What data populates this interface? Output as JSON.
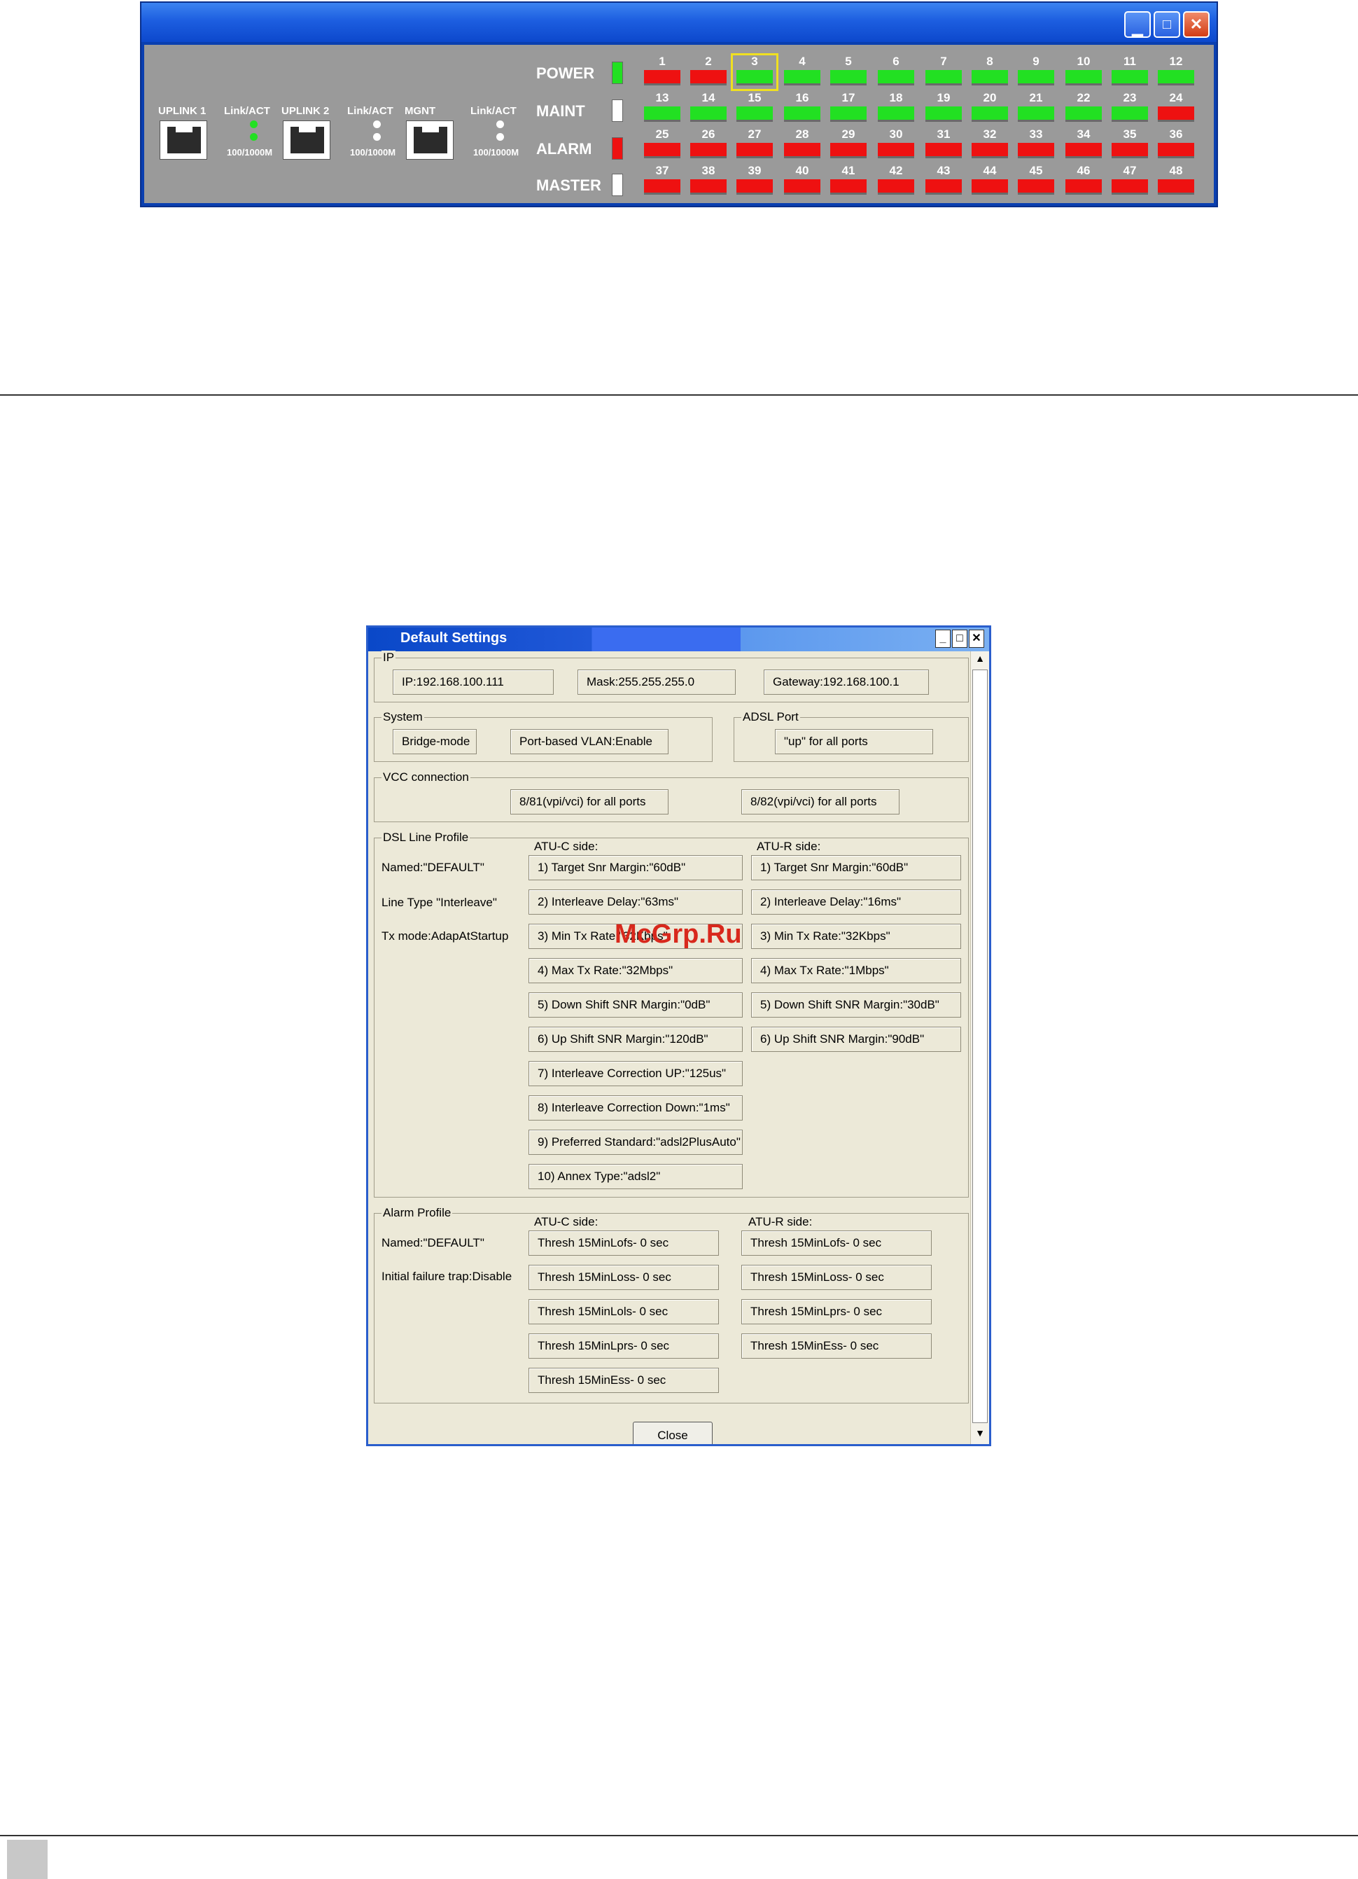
{
  "panel": {
    "uplinks": [
      {
        "name": "UPLINK 1",
        "link": "Link/ACT",
        "speed": "100/1000M",
        "led1": "#22e022",
        "led2": "#22e022"
      },
      {
        "name": "UPLINK 2",
        "link": "Link/ACT",
        "speed": "100/1000M",
        "led1": "#ffffff",
        "led2": "#ffffff"
      },
      {
        "name": "MGNT",
        "link": "Link/ACT",
        "speed": "100/1000M",
        "led1": "#ffffff",
        "led2": "#ffffff"
      }
    ],
    "system_leds": [
      {
        "label": "POWER",
        "color": "#22e022"
      },
      {
        "label": "MAINT",
        "color": "#ffffff"
      },
      {
        "label": "ALARM",
        "color": "#ee1111"
      },
      {
        "label": "MASTER",
        "color": "#ffffff"
      }
    ],
    "ports": [
      {
        "n": "1",
        "s": "red"
      },
      {
        "n": "2",
        "s": "red"
      },
      {
        "n": "3",
        "s": "green"
      },
      {
        "n": "4",
        "s": "green"
      },
      {
        "n": "5",
        "s": "green"
      },
      {
        "n": "6",
        "s": "green"
      },
      {
        "n": "7",
        "s": "green"
      },
      {
        "n": "8",
        "s": "green"
      },
      {
        "n": "9",
        "s": "green"
      },
      {
        "n": "10",
        "s": "green"
      },
      {
        "n": "11",
        "s": "green"
      },
      {
        "n": "12",
        "s": "green"
      },
      {
        "n": "13",
        "s": "green"
      },
      {
        "n": "14",
        "s": "green"
      },
      {
        "n": "15",
        "s": "green"
      },
      {
        "n": "16",
        "s": "green"
      },
      {
        "n": "17",
        "s": "green"
      },
      {
        "n": "18",
        "s": "green"
      },
      {
        "n": "19",
        "s": "green"
      },
      {
        "n": "20",
        "s": "green"
      },
      {
        "n": "21",
        "s": "green"
      },
      {
        "n": "22",
        "s": "green"
      },
      {
        "n": "23",
        "s": "green"
      },
      {
        "n": "24",
        "s": "red"
      },
      {
        "n": "25",
        "s": "red"
      },
      {
        "n": "26",
        "s": "red"
      },
      {
        "n": "27",
        "s": "red"
      },
      {
        "n": "28",
        "s": "red"
      },
      {
        "n": "29",
        "s": "red"
      },
      {
        "n": "30",
        "s": "red"
      },
      {
        "n": "31",
        "s": "red"
      },
      {
        "n": "32",
        "s": "red"
      },
      {
        "n": "33",
        "s": "red"
      },
      {
        "n": "34",
        "s": "red"
      },
      {
        "n": "35",
        "s": "red"
      },
      {
        "n": "36",
        "s": "red"
      },
      {
        "n": "37",
        "s": "red"
      },
      {
        "n": "38",
        "s": "red"
      },
      {
        "n": "39",
        "s": "red"
      },
      {
        "n": "40",
        "s": "red"
      },
      {
        "n": "41",
        "s": "red"
      },
      {
        "n": "42",
        "s": "red"
      },
      {
        "n": "43",
        "s": "red"
      },
      {
        "n": "44",
        "s": "red"
      },
      {
        "n": "45",
        "s": "red"
      },
      {
        "n": "46",
        "s": "red"
      },
      {
        "n": "47",
        "s": "red"
      },
      {
        "n": "48",
        "s": "red"
      }
    ],
    "selected_port": "3",
    "colors": {
      "green": "#22e022",
      "red": "#ee1111",
      "selection": "#f0e020"
    }
  },
  "dialog": {
    "title": "Default Settings",
    "ip": {
      "legend": "IP",
      "ip": "IP:192.168.100.111",
      "mask": "Mask:255.255.255.0",
      "gateway": "Gateway:192.168.100.1"
    },
    "system": {
      "legend": "System",
      "mode": "Bridge-mode",
      "vlan": "Port-based VLAN:Enable"
    },
    "adsl_port": {
      "legend": "ADSL Port",
      "value": "\"up\" for all ports"
    },
    "vcc": {
      "legend": "VCC connection",
      "vcc1": "8/81(vpi/vci) for all ports",
      "vcc2": "8/82(vpi/vci) for all ports"
    },
    "dsl_profile": {
      "legend": "DSL Line Profile",
      "named": "Named:\"DEFAULT\"",
      "line_type": "Line Type \"Interleave\"",
      "tx_mode": "Tx mode:AdapAtStartup",
      "atuc_header": "ATU-C side:",
      "atur_header": "ATU-R side:",
      "atuc": [
        "1) Target Snr Margin:\"60dB\"",
        "2) Interleave Delay:\"63ms\"",
        "3) Min Tx Rate:\"32Kbps\"",
        "4) Max Tx Rate:\"32Mbps\"",
        "5) Down Shift SNR Margin:\"0dB\"",
        "6) Up Shift SNR Margin:\"120dB\"",
        "7) Interleave Correction UP:\"125us\"",
        "8) Interleave Correction Down:\"1ms\"",
        "9) Preferred Standard:\"adsl2PlusAuto\"",
        "10) Annex Type:\"adsl2\""
      ],
      "atur": [
        "1) Target Snr Margin:\"60dB\"",
        "2) Interleave Delay:\"16ms\"",
        "3) Min Tx Rate:\"32Kbps\"",
        "4) Max Tx Rate:\"1Mbps\"",
        "5) Down Shift SNR Margin:\"30dB\"",
        "6) Up Shift SNR Margin:\"90dB\""
      ]
    },
    "alarm_profile": {
      "legend": "Alarm Profile",
      "named": "Named:\"DEFAULT\"",
      "trap": "Initial failure trap:Disable",
      "atuc_header": "ATU-C side:",
      "atur_header": "ATU-R side:",
      "atuc": [
        "Thresh 15MinLofs- 0 sec",
        "Thresh 15MinLoss- 0 sec",
        "Thresh 15MinLols- 0 sec",
        "Thresh 15MinLprs- 0 sec",
        "Thresh 15MinEss- 0 sec"
      ],
      "atur": [
        "Thresh 15MinLofs- 0 sec",
        "Thresh 15MinLoss- 0 sec",
        "Thresh 15MinLprs- 0 sec",
        "Thresh 15MinEss- 0 sec"
      ]
    },
    "close_label": "Close"
  },
  "watermark": "McGrp.Ru"
}
